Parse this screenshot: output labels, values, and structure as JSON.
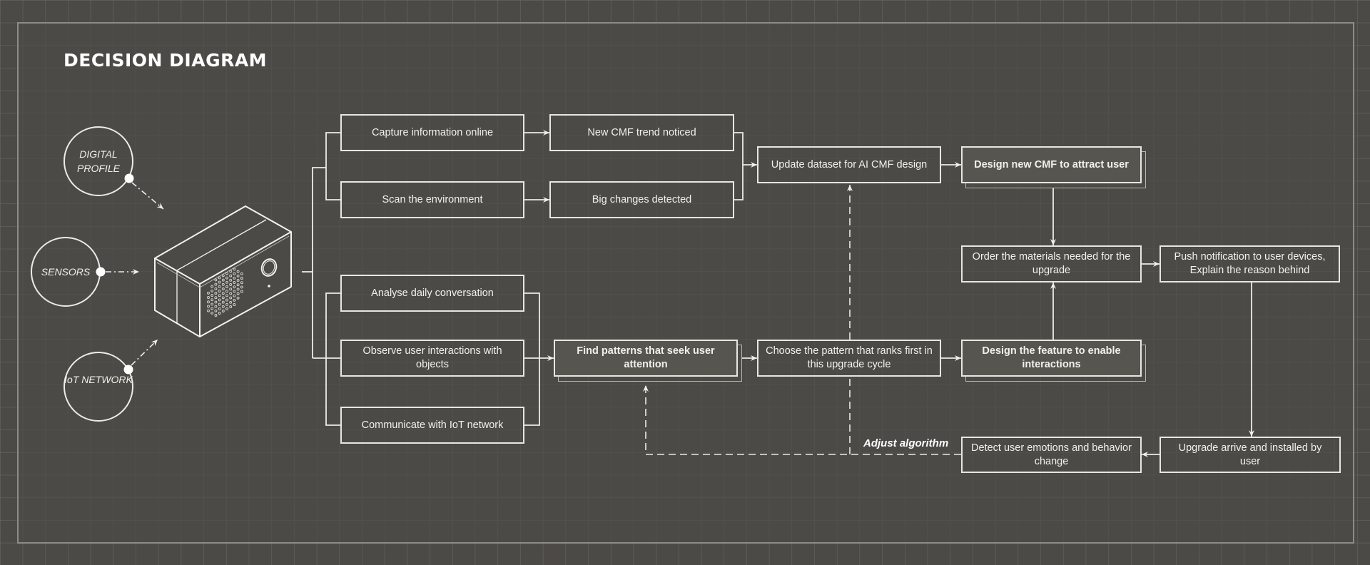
{
  "title": "DECISION DIAGRAM",
  "colors": {
    "background": "#4c4a46",
    "line": "#e8e6e0",
    "highlight_fill": "#57554f"
  },
  "inputs": [
    {
      "id": "digital-profile",
      "label": "DIGITAL PROFILE"
    },
    {
      "id": "sensors",
      "label": "SENSORS"
    },
    {
      "id": "iot-network",
      "label": "IoT NETWORK"
    }
  ],
  "device": {
    "name": "smart-device",
    "icon": "isometric-device-icon"
  },
  "nodes": {
    "capture": "Capture information online",
    "scan": "Scan the environment",
    "new_cmf_trend": "New CMF trend noticed",
    "big_changes": "Big changes detected",
    "update_dataset": "Update dataset for AI CMF design",
    "design_cmf": "Design new CMF to attract user",
    "analyse": "Analyse daily conversation",
    "observe": "Observe user interactions with objects",
    "communicate": "Communicate with IoT network",
    "find_patterns": "Find patterns that seek user attention",
    "choose_pattern": "Choose the pattern that ranks first in this upgrade cycle",
    "design_feature": "Design the feature to enable interactions",
    "order_materials": "Order the materials needed for the upgrade",
    "push_notification": "Push notification to user devices, Explain the reason behind",
    "upgrade_arrive": "Upgrade arrive and installed by user",
    "detect_emotions": "Detect user emotions and behavior change"
  },
  "annotations": {
    "adjust": "Adjust algorithm"
  }
}
